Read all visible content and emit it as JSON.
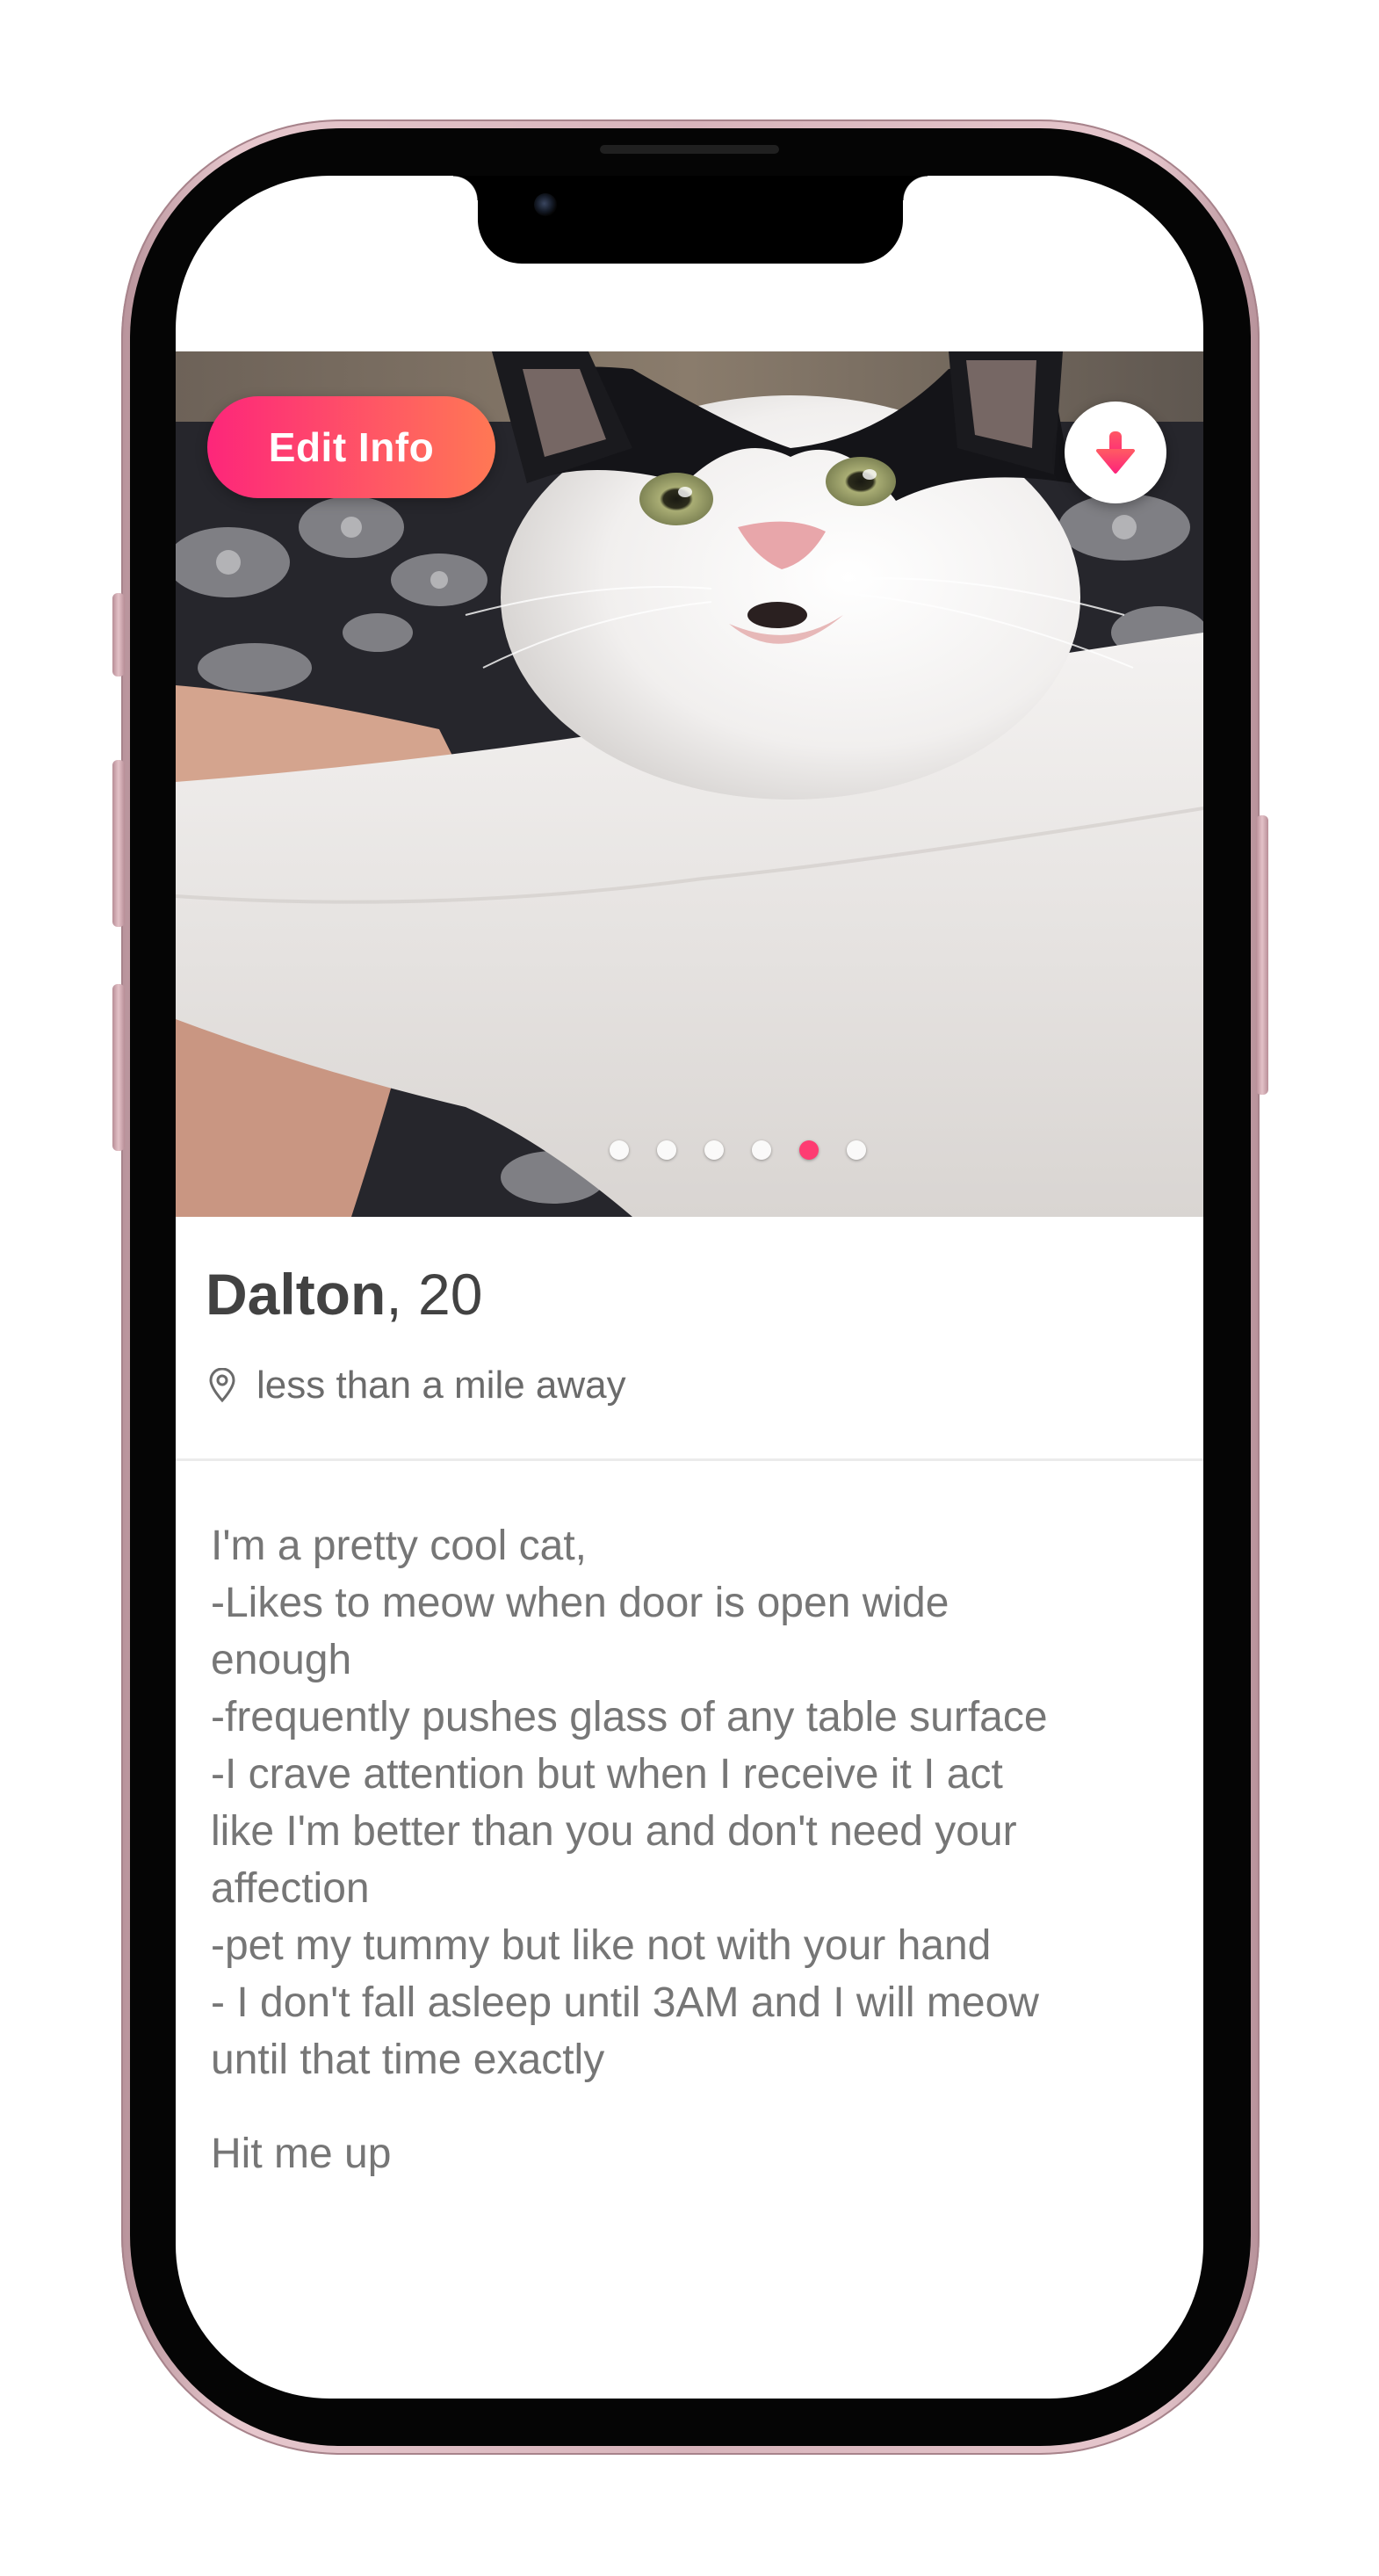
{
  "profile": {
    "name": "Dalton",
    "age_separator": ", ",
    "age": "20",
    "distance": "less than a mile away",
    "bio_lines": [
      "I'm a pretty cool cat,",
      "-Likes to meow when door is open wide",
      "enough",
      "-frequently pushes glass of any table surface",
      "-I crave attention but when I receive it I act",
      "like I'm better than you and don't need your",
      "affection",
      "-pet my tummy but like not with your hand",
      "- I don't fall asleep until 3AM and I will meow",
      "until that time exactly"
    ],
    "bio_closing": "Hit me up"
  },
  "actions": {
    "edit_info_label": "Edit Info",
    "collapse_icon": "arrow-down-icon"
  },
  "photos": {
    "count": 6,
    "active_index": 4
  },
  "colors": {
    "brand_gradient_start": "#fd267a",
    "brand_gradient_end": "#ff7854",
    "accent": "#fe3c72",
    "name_text": "#424242",
    "bio_text": "#767676"
  },
  "icons": {
    "location": "location-pin-icon"
  }
}
